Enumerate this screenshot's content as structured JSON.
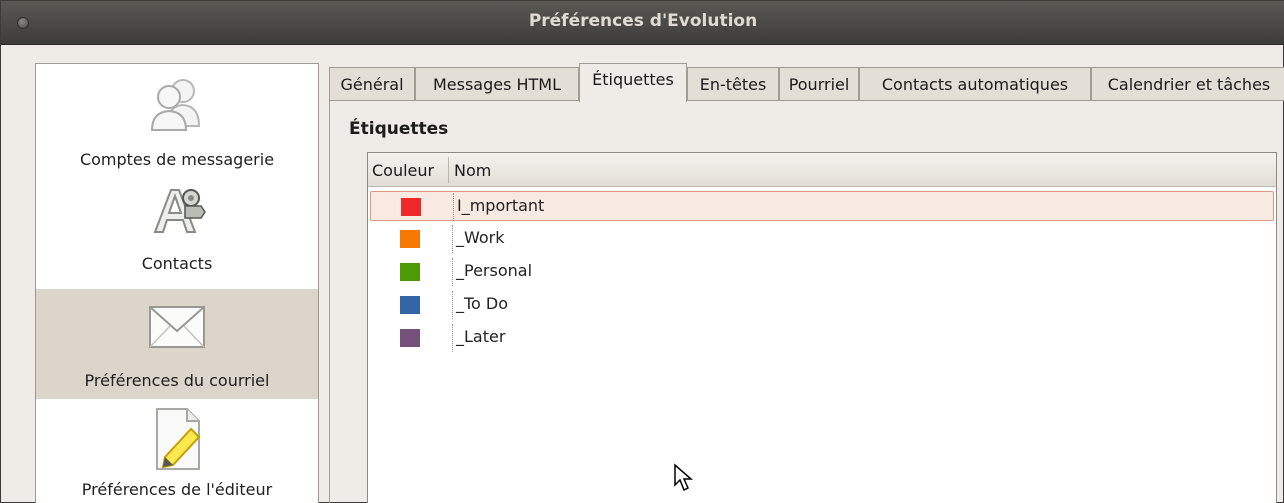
{
  "window": {
    "title": "Préférences d'Evolution"
  },
  "sidebar": {
    "items": [
      {
        "label": "Comptes de messagerie",
        "icon": "accounts-icon"
      },
      {
        "label": "Contacts",
        "icon": "contacts-icon"
      },
      {
        "label": "Préférences du courriel",
        "icon": "mail-icon",
        "selected": true
      },
      {
        "label": "Préférences de l'éditeur",
        "icon": "editor-icon"
      }
    ]
  },
  "tabs": [
    {
      "label": "Général"
    },
    {
      "label": "Messages HTML"
    },
    {
      "label": "Étiquettes",
      "active": true
    },
    {
      "label": "En-têtes"
    },
    {
      "label": "Pourriel"
    },
    {
      "label": "Contacts automatiques"
    },
    {
      "label": "Calendrier et tâches"
    }
  ],
  "labels_section": {
    "title": "Étiquettes",
    "columns": [
      "Couleur",
      "Nom"
    ],
    "rows": [
      {
        "name": "I_mportant",
        "color": "#ef2929",
        "selected": true
      },
      {
        "name": "_Work",
        "color": "#f57900"
      },
      {
        "name": "_Personal",
        "color": "#4e9a06"
      },
      {
        "name": "_To Do",
        "color": "#3465a4"
      },
      {
        "name": "_Later",
        "color": "#75507b"
      }
    ]
  }
}
